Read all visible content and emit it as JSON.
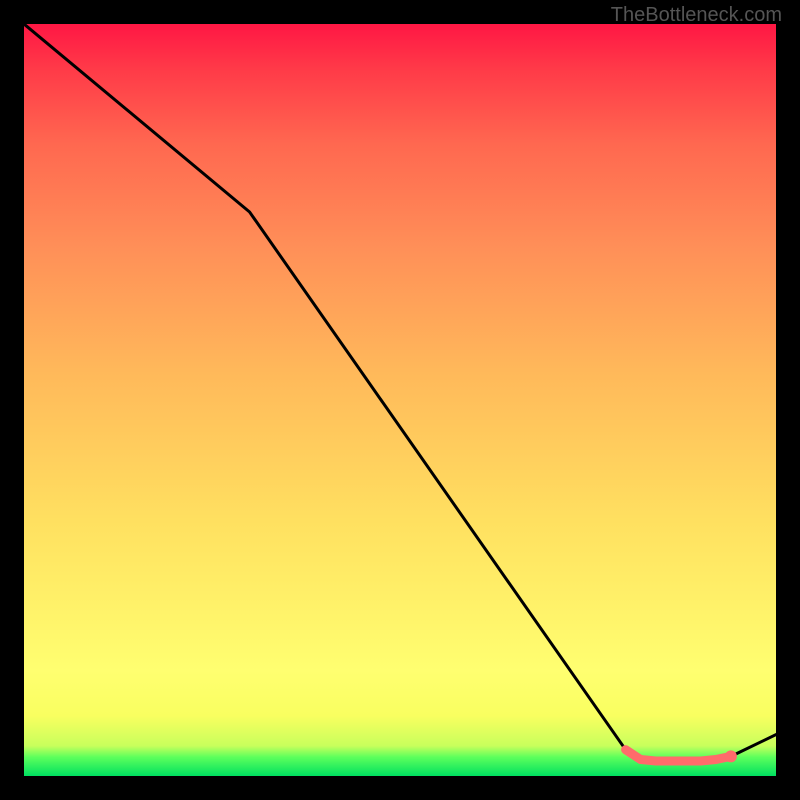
{
  "watermark": "TheBottleneck.com",
  "chart_data": {
    "type": "line",
    "title": "",
    "xlabel": "",
    "ylabel": "",
    "xlim": [
      0,
      100
    ],
    "ylim": [
      0,
      100
    ],
    "grid": false,
    "series": [
      {
        "name": "curve",
        "x": [
          0,
          30,
          80,
          82,
          84,
          86,
          88,
          90,
          92,
          94,
          100
        ],
        "values": [
          100,
          75,
          3.5,
          2.2,
          2.0,
          2.0,
          2.0,
          2.0,
          2.2,
          2.6,
          5.5
        ],
        "color": "#000000"
      }
    ],
    "highlight_range": {
      "x_start": 80,
      "x_end": 94,
      "color": "#ff6b6b"
    }
  }
}
